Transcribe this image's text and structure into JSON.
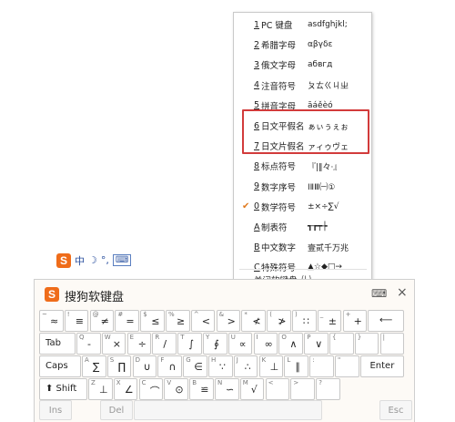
{
  "menu": {
    "items": [
      {
        "num": "1",
        "name": "PC 键盘",
        "sample": "asdfghjkl;",
        "checked": false
      },
      {
        "num": "2",
        "name": "希腊字母",
        "sample": "αβγδε",
        "checked": false
      },
      {
        "num": "3",
        "name": "俄文字母",
        "sample": "абвгд",
        "checked": false
      },
      {
        "num": "4",
        "name": "注音符号",
        "sample": "ㄆㄊㄍㄐㄓ",
        "checked": false
      },
      {
        "num": "5",
        "name": "拼音字母",
        "sample": "āáěèó",
        "checked": false
      },
      {
        "num": "6",
        "name": "日文平假名",
        "sample": "ぁぃぅぇぉ",
        "checked": false
      },
      {
        "num": "7",
        "name": "日文片假名",
        "sample": "ァィゥヴェ",
        "checked": false
      },
      {
        "num": "8",
        "name": "标点符号",
        "sample": "『|‖々·』",
        "checked": false
      },
      {
        "num": "9",
        "name": "数字序号",
        "sample": "ⅠⅡⅢ㈠①",
        "checked": false
      },
      {
        "num": "0",
        "name": "数学符号",
        "sample": "±×÷∑√",
        "checked": true
      },
      {
        "num": "A",
        "name": "制表符",
        "sample": "┱┲┯┾",
        "checked": false
      },
      {
        "num": "B",
        "name": "中文数字",
        "sample": "壹贰千万兆",
        "checked": false
      },
      {
        "num": "C",
        "name": "特殊符号",
        "sample": "▲☆◆□→",
        "checked": false
      }
    ],
    "close": {
      "name": "关闭软键盘",
      "shortcut": "(L)"
    },
    "check_mark": "✔"
  },
  "imebar": {
    "logo": "S",
    "mode": "中",
    "moon": "☽",
    "punct": "°,",
    "kbd": "⌨"
  },
  "keyboard": {
    "title": "搜狗软键盘",
    "logo": "S",
    "keyboard_icon": "⌨",
    "close_icon": "×",
    "row1": [
      {
        "sup": "~",
        "main": "≈"
      },
      {
        "sup": "!",
        "main": "≡"
      },
      {
        "sup": "@",
        "main": "≠"
      },
      {
        "sup": "#",
        "main": "="
      },
      {
        "sup": "$",
        "main": "≤"
      },
      {
        "sup": "%",
        "main": "≥"
      },
      {
        "sup": "^",
        "main": "<"
      },
      {
        "sup": "&",
        "main": ">"
      },
      {
        "sup": "*",
        "main": "≮"
      },
      {
        "sup": "(",
        "main": "≯"
      },
      {
        "sup": ")",
        "main": "∷"
      },
      {
        "sup": "_",
        "main": "±"
      },
      {
        "sup": "+",
        "main": "+"
      }
    ],
    "backspace": "⟵",
    "row2": [
      {
        "sup": "Q",
        "main": "-"
      },
      {
        "sup": "W",
        "main": "×"
      },
      {
        "sup": "E",
        "main": "÷"
      },
      {
        "sup": "R",
        "main": "/"
      },
      {
        "sup": "T",
        "main": "∫"
      },
      {
        "sup": "Y",
        "main": "∮"
      },
      {
        "sup": "U",
        "main": "∝"
      },
      {
        "sup": "I",
        "main": "∞"
      },
      {
        "sup": "O",
        "main": "∧"
      },
      {
        "sup": "P",
        "main": "∨"
      },
      {
        "sup": "{",
        "main": ""
      },
      {
        "sup": "}",
        "main": ""
      },
      {
        "sup": "|",
        "main": ""
      }
    ],
    "tab": "Tab",
    "row3": [
      {
        "sup": "A",
        "main": "∑"
      },
      {
        "sup": "S",
        "main": "∏"
      },
      {
        "sup": "D",
        "main": "∪"
      },
      {
        "sup": "F",
        "main": "∩"
      },
      {
        "sup": "G",
        "main": "∈"
      },
      {
        "sup": "H",
        "main": "∵"
      },
      {
        "sup": "J",
        "main": "∴"
      },
      {
        "sup": "K",
        "main": "⊥"
      },
      {
        "sup": "L",
        "main": "∥"
      },
      {
        "sup": ":",
        "main": ""
      },
      {
        "sup": "\"",
        "main": ""
      }
    ],
    "caps": "Caps",
    "enter": "Enter",
    "row4": [
      {
        "sup": "Z",
        "main": "⊥"
      },
      {
        "sup": "X",
        "main": "∠"
      },
      {
        "sup": "C",
        "main": "⌒"
      },
      {
        "sup": "V",
        "main": "⊙"
      },
      {
        "sup": "B",
        "main": "≌"
      },
      {
        "sup": "N",
        "main": "∽"
      },
      {
        "sup": "M",
        "main": "√"
      },
      {
        "sup": "<",
        "main": ""
      },
      {
        "sup": ">",
        "main": ""
      },
      {
        "sup": "?",
        "main": ""
      }
    ],
    "shift": "⬆ Shift",
    "ins": "Ins",
    "del": "Del",
    "esc": "Esc"
  }
}
